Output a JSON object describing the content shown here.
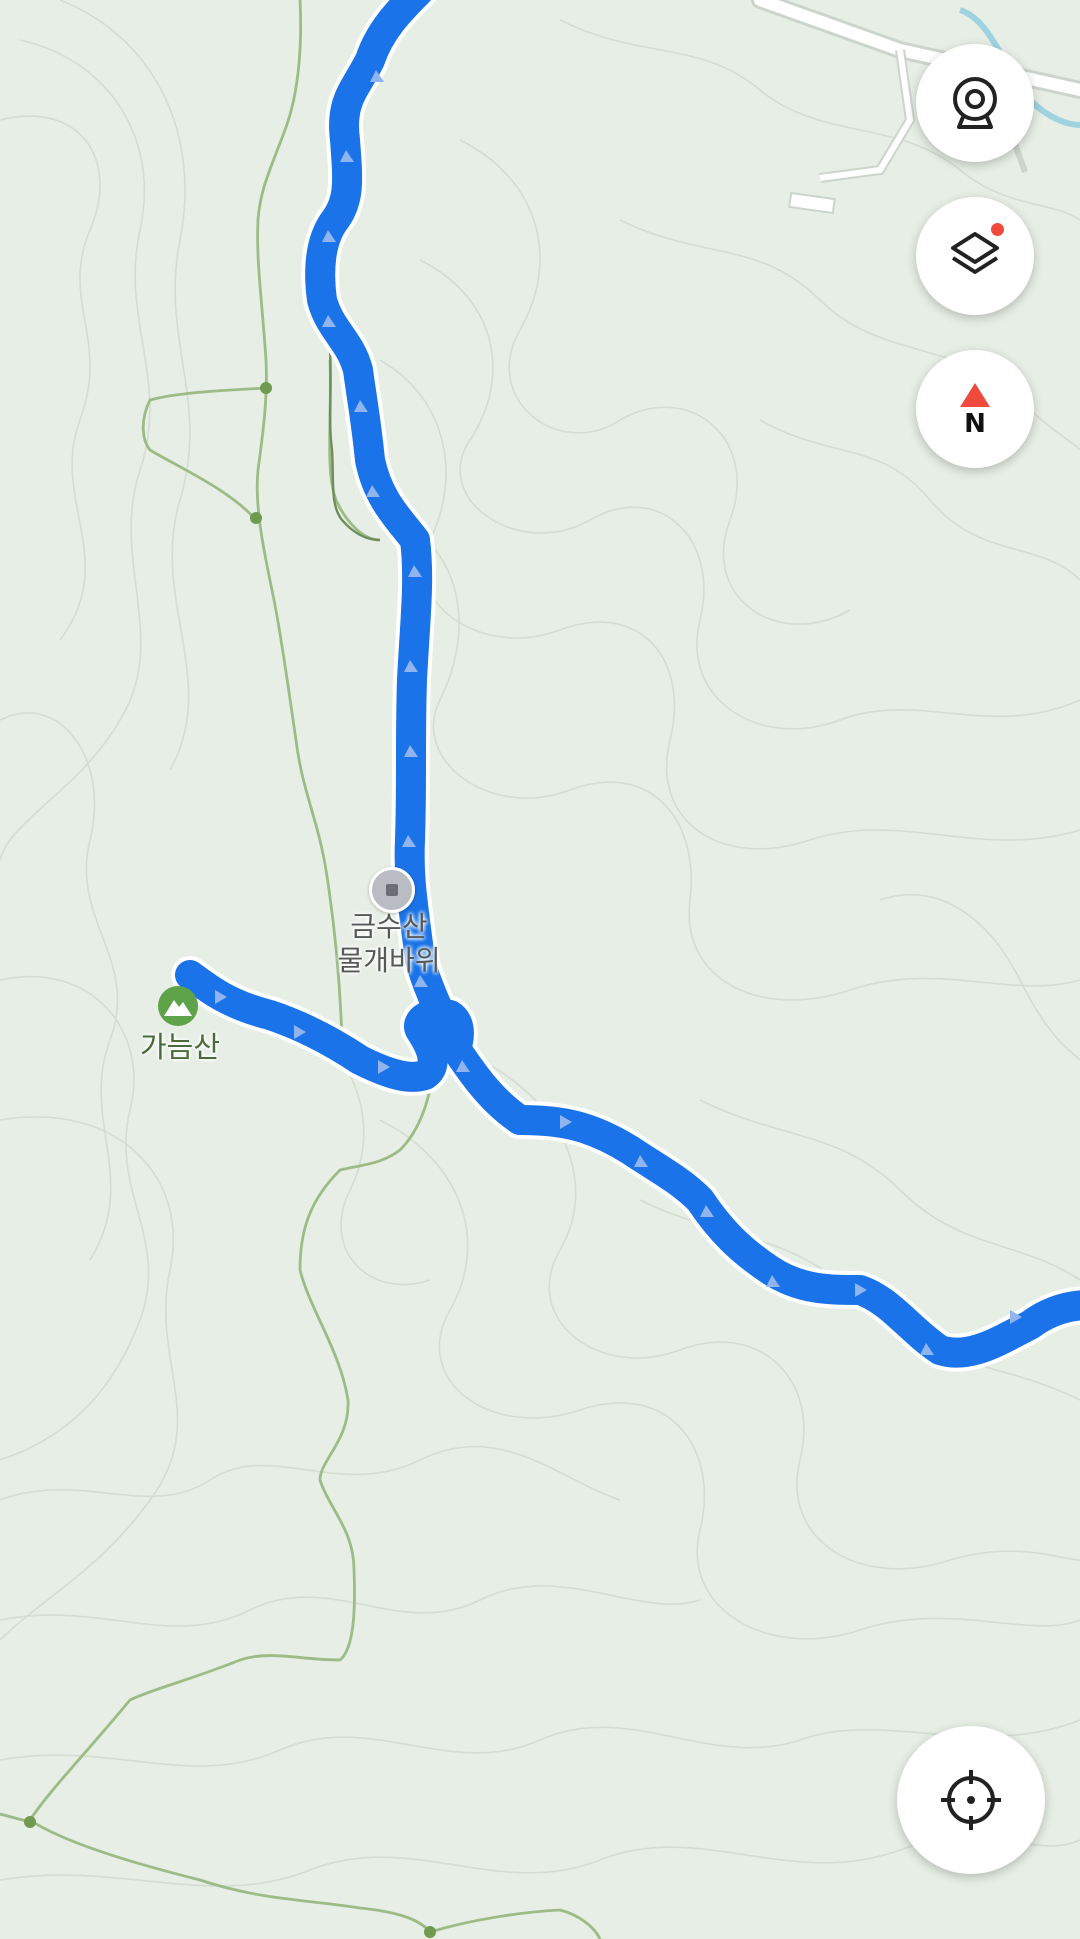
{
  "map": {
    "colors": {
      "background": "#e6eee5",
      "route": "#1a73e8",
      "trail": "#9dbb86",
      "contour": "#d4dfd3",
      "road": "#ffffff"
    },
    "places": {
      "poi": {
        "line1": "금수산",
        "line2": "물개바위",
        "icon": "poi-square-icon"
      },
      "peak": {
        "name": "가늠산",
        "icon": "mountain-icon"
      }
    },
    "controls": {
      "camera": {
        "icon": "camera-icon"
      },
      "layers": {
        "icon": "layers-icon",
        "badge": true,
        "badge_color": "#f04a3e"
      },
      "compass": {
        "icon": "compass-north-icon",
        "letter": "N",
        "color": "#f04a3e"
      },
      "locate": {
        "icon": "locate-crosshair-icon"
      }
    }
  }
}
